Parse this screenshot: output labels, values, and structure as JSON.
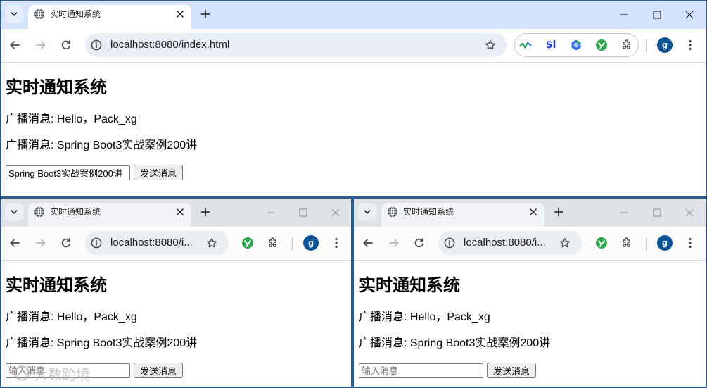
{
  "windows": [
    {
      "state": "active",
      "tab": {
        "title": "实时通知系统",
        "favicon": "globe-icon"
      },
      "address": {
        "url": "localhost:8080/index.html"
      },
      "extensions": {
        "badge_text": "$i",
        "icons": [
          "pulse-check-icon",
          "dollar-i-icon",
          "hexagon-cube-icon",
          "green-check-circle-icon",
          "puzzle-icon"
        ]
      },
      "profile": {
        "initial": "g"
      },
      "page": {
        "heading": "实时通知系统",
        "messages": [
          "广播消息: Hello，Pack_xg",
          "广播消息: Spring Boot3实战案例200讲"
        ],
        "message_input": {
          "value": "Spring Boot3实战案例200讲"
        },
        "send_button": "发送消息"
      }
    },
    {
      "state": "inactive",
      "tab": {
        "title": "实时通知系统",
        "favicon": "globe-icon"
      },
      "address": {
        "url": "localhost:8080/i..."
      },
      "extensions": {
        "icons": [
          "green-check-circle-icon",
          "puzzle-icon"
        ]
      },
      "profile": {
        "initial": "g"
      },
      "page": {
        "heading": "实时通知系统",
        "messages": [
          "广播消息: Hello，Pack_xg",
          "广播消息: Spring Boot3实战案例200讲"
        ],
        "message_input": {
          "value": "",
          "placeholder": "输入消息"
        },
        "send_button": "发送消息"
      }
    },
    {
      "state": "inactive",
      "tab": {
        "title": "实时通知系统",
        "favicon": "globe-icon"
      },
      "address": {
        "url": "localhost:8080/i..."
      },
      "extensions": {
        "icons": [
          "green-check-circle-icon",
          "puzzle-icon"
        ]
      },
      "profile": {
        "initial": "g"
      },
      "page": {
        "heading": "实时通知系统",
        "messages": [
          "广播消息: Hello，Pack_xg",
          "广播消息: Spring Boot3实战案例200讲"
        ],
        "message_input": {
          "value": "",
          "placeholder": "输入消息"
        },
        "send_button": "发送消息"
      }
    }
  ],
  "watermark": "大数跨境",
  "colors": {
    "frame_active": "#d3e3fd",
    "frame_inactive": "#dfe3e8",
    "avatar": "#0b5394",
    "desktop_border": "#2b5c8e"
  }
}
